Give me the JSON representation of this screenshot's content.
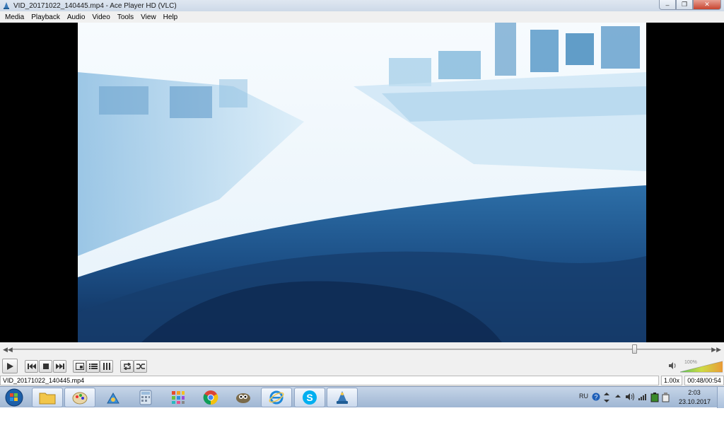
{
  "window": {
    "title": "VID_20171022_140445.mp4 - Ace Player HD (VLC)",
    "minimize_icon": "minimize-icon",
    "restore_icon": "restore-icon",
    "close_icon": "close-icon"
  },
  "menu": {
    "items": [
      "Media",
      "Playback",
      "Audio",
      "Video",
      "Tools",
      "View",
      "Help"
    ]
  },
  "video": {
    "content": "dashcam view of a road through a car windshield"
  },
  "seek": {
    "position_fraction": 0.89
  },
  "controls": {
    "buttons": [
      "play-icon",
      "previous-icon",
      "stop-icon",
      "next-icon",
      "fullscreen-icon",
      "playlist-icon",
      "equalizer-icon",
      "loop-icon",
      "shuffle-icon"
    ],
    "volume_percent": "100%"
  },
  "status": {
    "filename": "VID_20171022_140445.mp4",
    "speed": "1.00x",
    "time": "00:48/00:54"
  },
  "taskbar": {
    "apps": [
      "windows-explorer",
      "paint",
      "lab-tool",
      "calculator",
      "app-grid",
      "chrome",
      "gimp",
      "internet-explorer",
      "skype",
      "ace-player"
    ],
    "tray": {
      "language": "RU",
      "time": "2:03",
      "date": "23.10.2017"
    }
  },
  "colors": {
    "accent_blue": "#1e6fb5",
    "video_sky": "#eef6fb",
    "video_dashboard": "#1b3f70"
  }
}
